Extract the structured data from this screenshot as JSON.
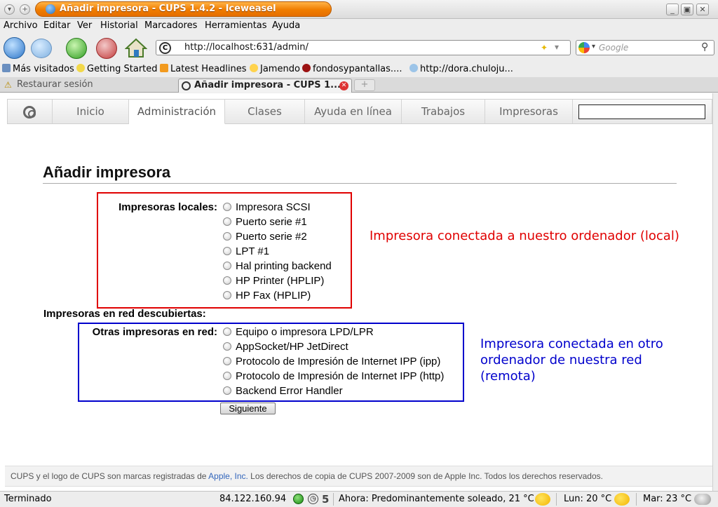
{
  "window": {
    "title": "Añadir impresora - CUPS 1.4.2 - Iceweasel",
    "controls": [
      "minimize-icon",
      "maximize-icon",
      "close-icon"
    ]
  },
  "menubar": {
    "items": [
      "Archivo",
      "Editar",
      "Ver",
      "Historial",
      "Marcadores",
      "Herramientas",
      "Ayuda"
    ]
  },
  "toolbar": {
    "url": "http://localhost:631/admin/",
    "search_placeholder": "Google"
  },
  "bookmarks": [
    {
      "label": "Más visitados",
      "icon": "bookmark-icon"
    },
    {
      "label": "Getting Started",
      "icon": "bulb-icon"
    },
    {
      "label": "Latest Headlines",
      "icon": "rss-icon"
    },
    {
      "label": "Jamendo",
      "icon": "play-icon"
    },
    {
      "label": "fondosypantallas....",
      "icon": "globe-icon"
    },
    {
      "label": "http://dora.chuloju...",
      "icon": "bulb-icon"
    }
  ],
  "tabs": [
    {
      "label": "Restaurar sesión",
      "active": false
    },
    {
      "label": "Añadir impresora - CUPS 1....",
      "active": true
    }
  ],
  "cups_nav": {
    "items": [
      "Inicio",
      "Administración",
      "Clases",
      "Ayuda en línea",
      "Trabajos",
      "Impresoras"
    ],
    "active": "Administración"
  },
  "page": {
    "title": "Añadir impresora",
    "local_label": "Impresoras locales:",
    "local_options": [
      "Impresora SCSI",
      "Puerto serie #1",
      "Puerto serie #2",
      "LPT #1",
      "Hal printing backend",
      "HP Printer (HPLIP)",
      "HP Fax (HPLIP)"
    ],
    "discovered_label": "Impresoras en red descubiertas:",
    "other_label": "Otras impresoras en red:",
    "other_options": [
      "Equipo o impresora LPD/LPR",
      "AppSocket/HP JetDirect",
      "Protocolo de Impresión de Internet IPP (ipp)",
      "Protocolo de Impresión de Internet IPP (http)",
      "Backend Error Handler"
    ],
    "next_button": "Siguiente",
    "note_local": "Impresora conectada a nuestro ordenador (local)",
    "note_remote_lines": [
      "Impresora conectada en otro",
      "ordenador de nuestra red",
      "(remota)"
    ],
    "note_local_color": "#e00000",
    "note_remote_color": "#0000cc"
  },
  "footer": {
    "prefix": "CUPS y el logo de CUPS son marcas registradas de ",
    "link": "Apple, Inc.",
    "suffix": " Los derechos de copia de CUPS 2007-2009 son de Apple Inc. Todos los derechos reservados."
  },
  "statusbar": {
    "status": "Terminado",
    "ip": "84.122.160.94",
    "counter": "5",
    "weather_now": "Ahora: Predominantemente soleado, 21 °C",
    "weather_mon": "Lun: 20 °C",
    "weather_tue": "Mar: 23 °C"
  }
}
